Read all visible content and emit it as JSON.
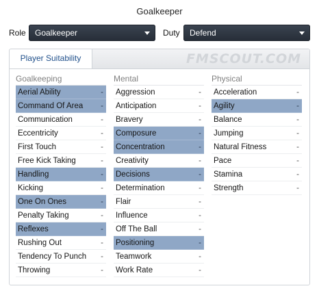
{
  "title": "Goalkeeper",
  "role": {
    "label": "Role",
    "value": "Goalkeeper"
  },
  "duty": {
    "label": "Duty",
    "value": "Defend"
  },
  "tab": {
    "label": "Player Suitability"
  },
  "watermark": "FMSCOUT.COM",
  "columns": [
    {
      "header": "Goalkeeping",
      "items": [
        {
          "name": "Aerial Ability",
          "value": "-",
          "highlighted": true
        },
        {
          "name": "Command Of Area",
          "value": "-",
          "highlighted": true
        },
        {
          "name": "Communication",
          "value": "-",
          "highlighted": false
        },
        {
          "name": "Eccentricity",
          "value": "-",
          "highlighted": false
        },
        {
          "name": "First Touch",
          "value": "-",
          "highlighted": false
        },
        {
          "name": "Free Kick Taking",
          "value": "-",
          "highlighted": false
        },
        {
          "name": "Handling",
          "value": "-",
          "highlighted": true
        },
        {
          "name": "Kicking",
          "value": "-",
          "highlighted": false
        },
        {
          "name": "One On Ones",
          "value": "-",
          "highlighted": true
        },
        {
          "name": "Penalty Taking",
          "value": "-",
          "highlighted": false
        },
        {
          "name": "Reflexes",
          "value": "-",
          "highlighted": true
        },
        {
          "name": "Rushing Out",
          "value": "-",
          "highlighted": false
        },
        {
          "name": "Tendency To Punch",
          "value": "-",
          "highlighted": false
        },
        {
          "name": "Throwing",
          "value": "-",
          "highlighted": false
        }
      ]
    },
    {
      "header": "Mental",
      "items": [
        {
          "name": "Aggression",
          "value": "-",
          "highlighted": false
        },
        {
          "name": "Anticipation",
          "value": "-",
          "highlighted": false
        },
        {
          "name": "Bravery",
          "value": "-",
          "highlighted": false
        },
        {
          "name": "Composure",
          "value": "-",
          "highlighted": true
        },
        {
          "name": "Concentration",
          "value": "-",
          "highlighted": true
        },
        {
          "name": "Creativity",
          "value": "-",
          "highlighted": false
        },
        {
          "name": "Decisions",
          "value": "-",
          "highlighted": true
        },
        {
          "name": "Determination",
          "value": "-",
          "highlighted": false
        },
        {
          "name": "Flair",
          "value": "-",
          "highlighted": false
        },
        {
          "name": "Influence",
          "value": "-",
          "highlighted": false
        },
        {
          "name": "Off The Ball",
          "value": "-",
          "highlighted": false
        },
        {
          "name": "Positioning",
          "value": "-",
          "highlighted": true
        },
        {
          "name": "Teamwork",
          "value": "-",
          "highlighted": false
        },
        {
          "name": "Work Rate",
          "value": "-",
          "highlighted": false
        }
      ]
    },
    {
      "header": "Physical",
      "items": [
        {
          "name": "Acceleration",
          "value": "-",
          "highlighted": false
        },
        {
          "name": "Agility",
          "value": "-",
          "highlighted": true
        },
        {
          "name": "Balance",
          "value": "-",
          "highlighted": false
        },
        {
          "name": "Jumping",
          "value": "-",
          "highlighted": false
        },
        {
          "name": "Natural Fitness",
          "value": "-",
          "highlighted": false
        },
        {
          "name": "Pace",
          "value": "-",
          "highlighted": false
        },
        {
          "name": "Stamina",
          "value": "-",
          "highlighted": false
        },
        {
          "name": "Strength",
          "value": "-",
          "highlighted": false
        }
      ]
    }
  ],
  "colors": {
    "highlight": "#8fa7c6",
    "dropdown_bg": "#2c333e",
    "tab_text": "#1f4f8a"
  }
}
